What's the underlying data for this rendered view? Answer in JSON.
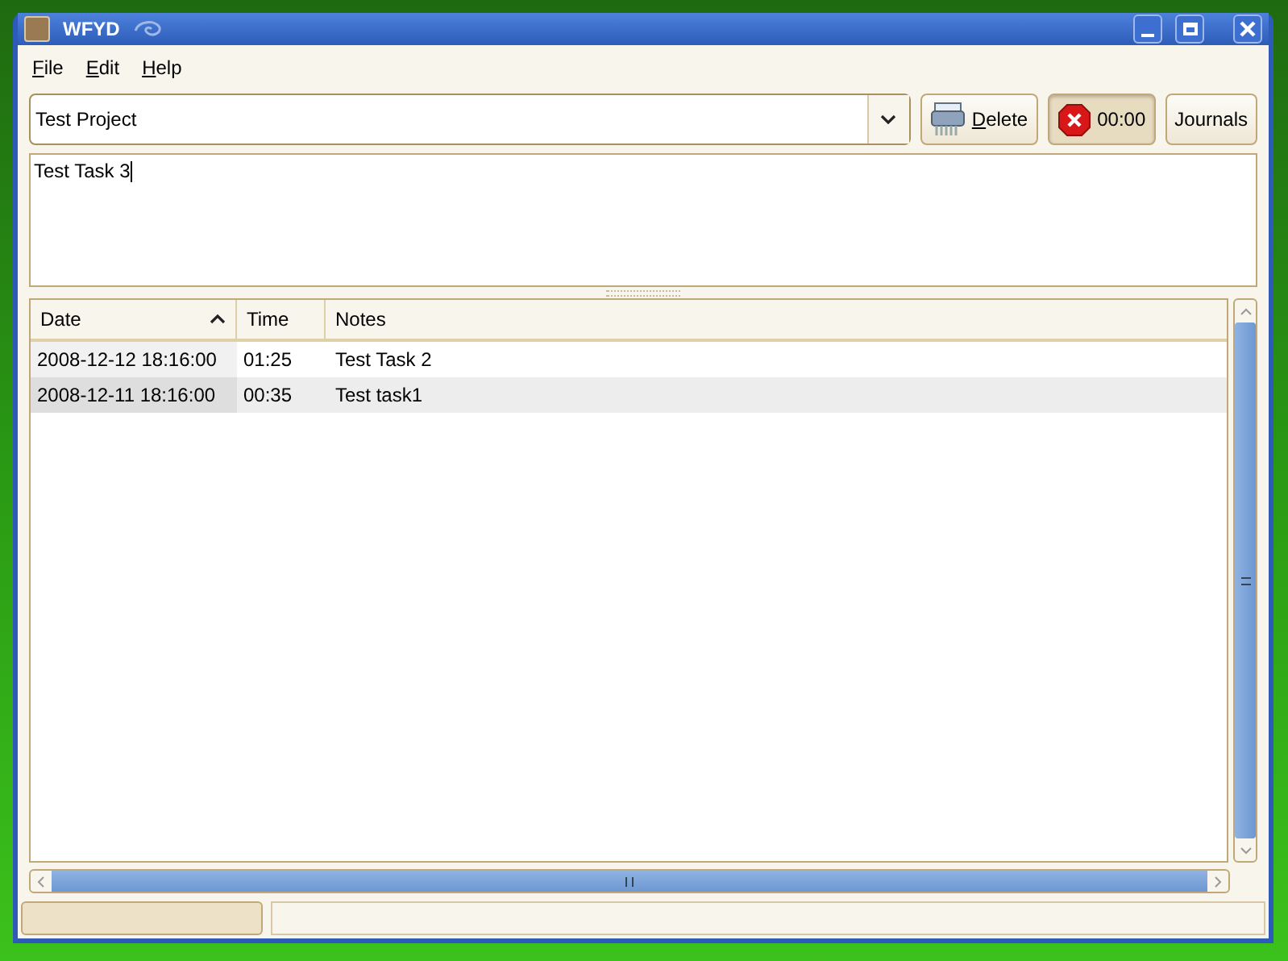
{
  "window": {
    "title": "WFYD"
  },
  "menu": [
    {
      "label": "File"
    },
    {
      "label": "Edit"
    },
    {
      "label": "Help"
    }
  ],
  "project": {
    "value": "Test Project"
  },
  "toolbar": {
    "delete": "Delete",
    "timer": {
      "label": "00:00",
      "pressed": true
    },
    "journals": "Journals"
  },
  "task_notes": {
    "value": "Test Task 3"
  },
  "table": {
    "columns": [
      {
        "label": "Date",
        "sorted": true
      },
      {
        "label": "Time",
        "sorted": false
      },
      {
        "label": "Notes",
        "sorted": false
      }
    ],
    "rows": [
      [
        "2008-12-12 18:16:00",
        "01:25",
        "Test Task 2"
      ],
      [
        "2008-12-11 18:16:00",
        "00:35",
        "Test task1"
      ]
    ]
  }
}
